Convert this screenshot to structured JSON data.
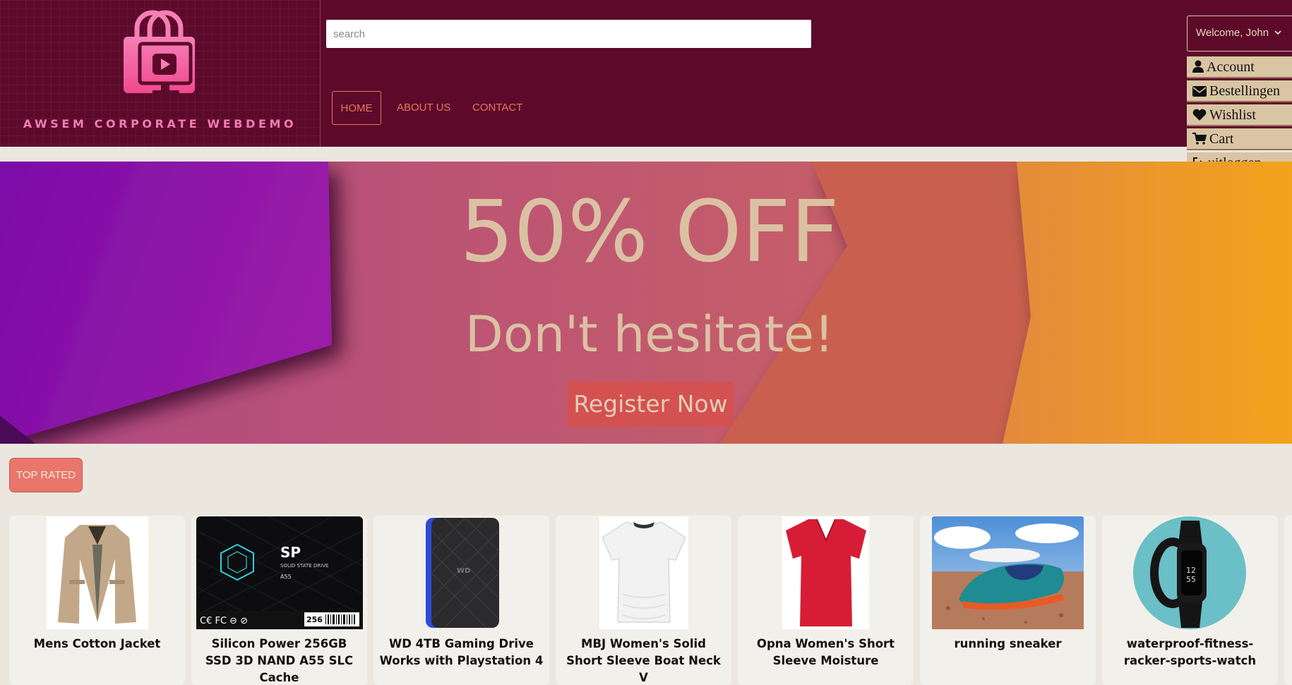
{
  "brand": {
    "name": "AWSEM CORPORATE WEBDEMO",
    "logo_icon": "shopping-bag-play-icon"
  },
  "search": {
    "placeholder": "search"
  },
  "nav": {
    "home": "HOME",
    "about": "ABOUT US",
    "contact": "CONTACT"
  },
  "user_menu": {
    "welcome": "Welcome, John",
    "items": [
      {
        "label": "Account",
        "icon": "user-icon"
      },
      {
        "label": "Bestellingen",
        "icon": "envelope-icon"
      },
      {
        "label": "Wishlist",
        "icon": "heart-icon"
      },
      {
        "label": "Cart",
        "icon": "cart-icon"
      },
      {
        "label": "uitloggen",
        "icon": "logout-icon"
      }
    ]
  },
  "hero": {
    "title": "50% OFF",
    "subtitle": "Don't hesitate!",
    "cta": "Register Now"
  },
  "section": {
    "top_rated": "TOP RATED"
  },
  "products": [
    {
      "name": "Mens Cotton Jacket"
    },
    {
      "name": "Silicon Power 256GB SSD 3D NAND A55 SLC Cache"
    },
    {
      "name": "WD 4TB Gaming Drive Works with Playstation 4"
    },
    {
      "name": "MBJ Women's Solid Short Sleeve Boat Neck V"
    },
    {
      "name": "Opna Women's Short Sleeve Moisture"
    },
    {
      "name": "running sneaker"
    },
    {
      "name": "waterproof-fitness-racker-sports-watch"
    }
  ],
  "colors": {
    "header_bg": "#5d0a2a",
    "logo_pink": "#f27bb4",
    "nav_accent": "#e8765f",
    "page_bg": "#ebe7df",
    "hero_text": "#ddc7a6",
    "cta_bg": "#d6514f"
  }
}
